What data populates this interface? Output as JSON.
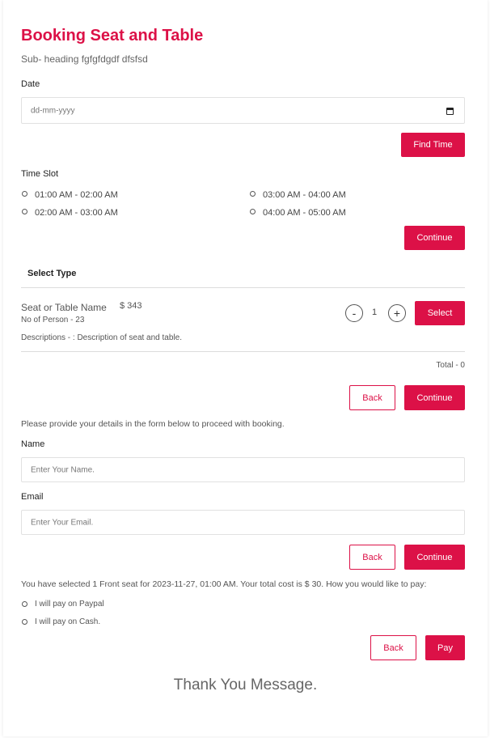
{
  "header": {
    "title": "Booking Seat and Table",
    "subtitle": "Sub- heading fgfgfdgdf dfsfsd"
  },
  "date": {
    "label": "Date",
    "placeholder": "dd-mm-yyyy",
    "icon": "calendar-icon",
    "find_time_label": "Find Time"
  },
  "time_slot": {
    "label": "Time Slot",
    "options": [
      "01:00 AM - 02:00 AM",
      "02:00 AM - 03:00 AM",
      "03:00 AM - 04:00 AM",
      "04:00 AM - 05:00 AM"
    ],
    "continue_label": "Continue"
  },
  "select_type": {
    "heading": "Select Type",
    "item": {
      "name": "Seat or Table Name",
      "price": "$ 343",
      "persons": "No of Person - 23",
      "description": "Descriptions - : Description of seat and table.",
      "quantity": "1",
      "minus": "-",
      "plus": "+",
      "select_label": "Select"
    },
    "total": "Total - 0",
    "back_label": "Back",
    "continue_label": "Continue"
  },
  "details": {
    "intro": "Please provide your details in the form below to proceed with booking.",
    "name_label": "Name",
    "name_placeholder": "Enter Your Name.",
    "email_label": "Email",
    "email_placeholder": "Enter Your Email.",
    "back_label": "Back",
    "continue_label": "Continue"
  },
  "payment": {
    "summary": "You have selected 1 Front seat for 2023-11-27, 01:00 AM. Your total cost is $ 30. How you would like to pay:",
    "options": [
      "I will pay on Paypal",
      "I will pay on Cash."
    ],
    "back_label": "Back",
    "pay_label": "Pay"
  },
  "thank_you": "Thank You Message.",
  "colors": {
    "accent": "#dc1147",
    "border": "#e1e1e1"
  }
}
